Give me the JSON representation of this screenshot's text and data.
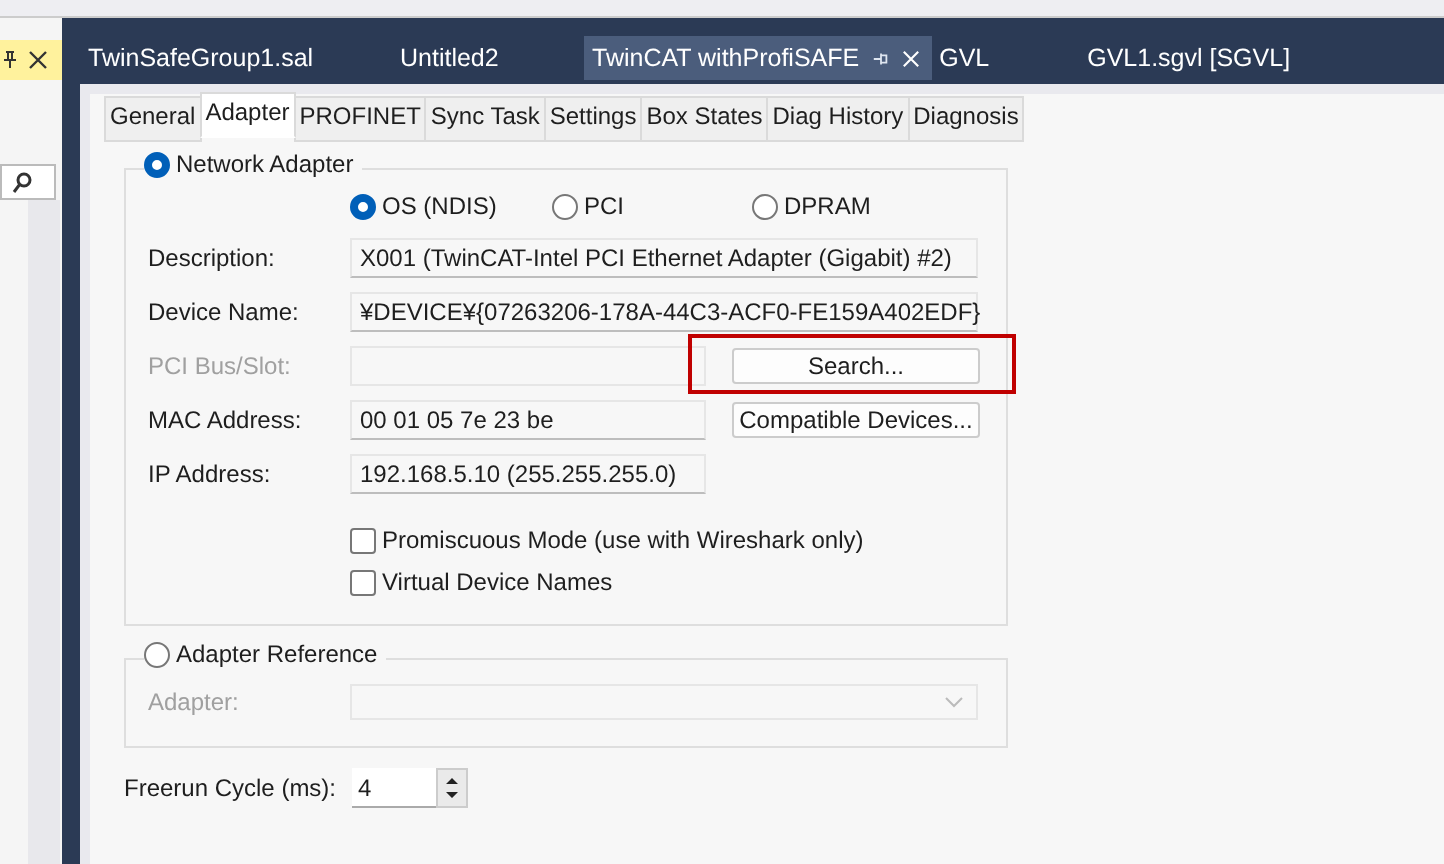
{
  "side_panel": {
    "pinned": true
  },
  "editor_tabs": [
    {
      "label": "TwinSafeGroup1.sal",
      "selected": false
    },
    {
      "label": "Untitled2",
      "selected": false
    },
    {
      "label": "TwinCAT withProfiSAFE",
      "selected": true
    },
    {
      "label": "GVL",
      "selected": false
    },
    {
      "label": "GVL1.sgvl [SGVL]",
      "selected": false
    }
  ],
  "property_tabs": [
    {
      "label": "General",
      "selected": false
    },
    {
      "label": "Adapter",
      "selected": true
    },
    {
      "label": "PROFINET",
      "selected": false
    },
    {
      "label": "Sync Task",
      "selected": false
    },
    {
      "label": "Settings",
      "selected": false
    },
    {
      "label": "Box States",
      "selected": false
    },
    {
      "label": "Diag History",
      "selected": false
    },
    {
      "label": "Diagnosis",
      "selected": false
    }
  ],
  "network_adapter": {
    "label": "Network Adapter",
    "selected": true,
    "adapter_types": [
      {
        "label": "OS (NDIS)",
        "selected": true
      },
      {
        "label": "PCI",
        "selected": false
      },
      {
        "label": "DPRAM",
        "selected": false
      }
    ],
    "fields": [
      {
        "label": "Description:",
        "value": "X001 (TwinCAT-Intel PCI Ethernet Adapter (Gigabit) #2)",
        "kind": "wide",
        "disabled": false
      },
      {
        "label": "Device Name:",
        "value": "¥DEVICE¥{07263206-178A-44C3-ACF0-FE159A402EDF}",
        "kind": "wide",
        "disabled": false
      },
      {
        "label": "PCI Bus/Slot:",
        "kind": "short",
        "disabled": true
      },
      {
        "label": "MAC Address:",
        "value": "00 01 05 7e 23 be",
        "kind": "short",
        "disabled": false
      },
      {
        "label": "IP Address:",
        "value": "192.168.5.10 (255.255.255.0)",
        "kind": "short",
        "disabled": false
      }
    ],
    "buttons": [
      {
        "label": "Search...",
        "highlighted": true
      },
      {
        "label": "Compatible Devices...",
        "highlighted": false
      }
    ],
    "options": [
      {
        "label": "Promiscuous Mode (use with Wireshark only)",
        "checked": false
      },
      {
        "label": "Virtual Device Names",
        "checked": false
      }
    ]
  },
  "adapter_reference": {
    "label": "Adapter Reference",
    "selected": false,
    "adapter_label": "Adapter:",
    "disabled": true
  },
  "freerun_cycle": {
    "label": "Freerun Cycle (ms):",
    "value": "4"
  }
}
